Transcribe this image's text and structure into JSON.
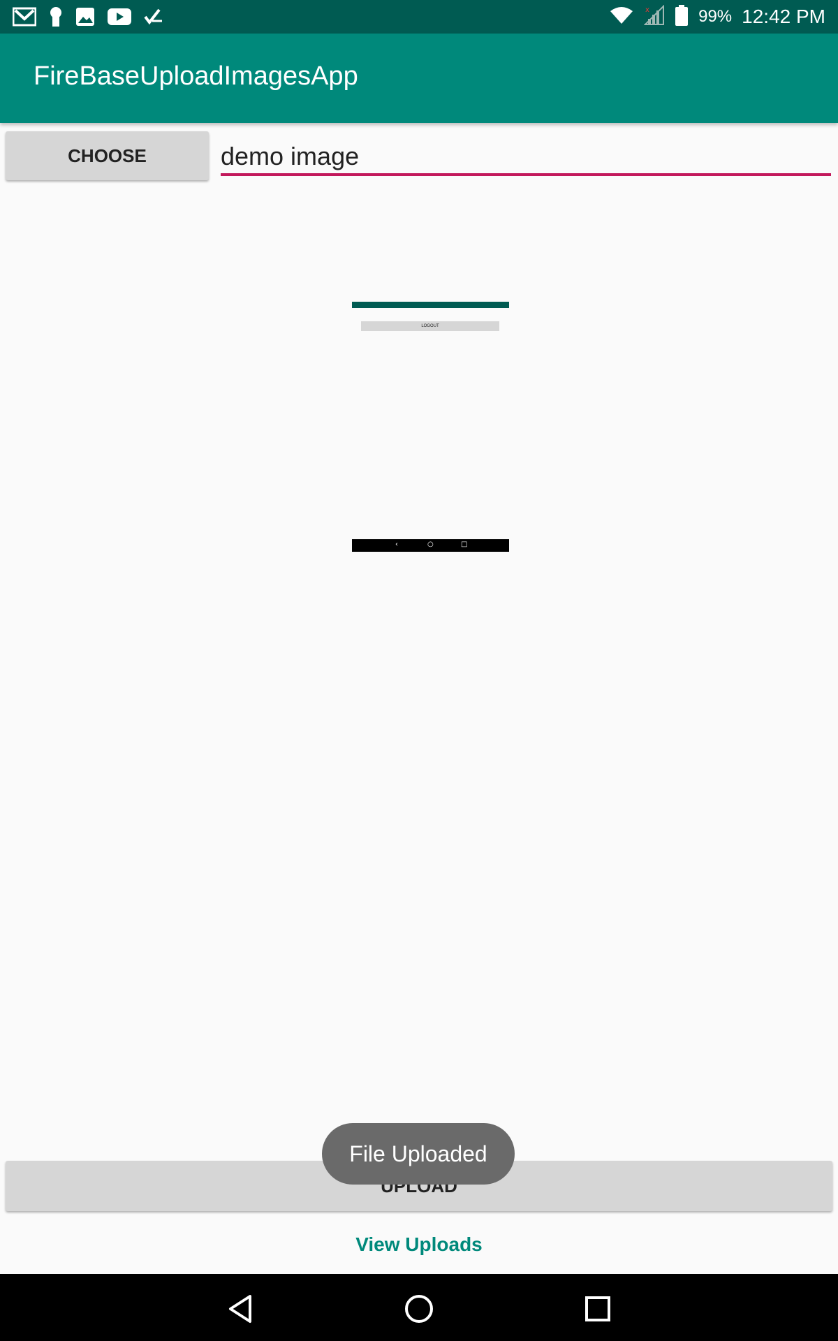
{
  "status_bar": {
    "battery_percent": "99%",
    "time": "12:42 PM",
    "left_icons": [
      "gmail-icon",
      "keyhole-icon",
      "image-icon",
      "youtube-icon",
      "checklist-icon"
    ],
    "right_icons": [
      "wifi-icon",
      "signal-icon",
      "battery-icon"
    ]
  },
  "app_bar": {
    "title": "FireBaseUploadImagesApp",
    "color": "#00897b"
  },
  "form": {
    "choose_label": "CHOOSE",
    "file_name_value": "demo image",
    "upload_label": "UPLOAD",
    "view_uploads_label": "View Uploads"
  },
  "preview": {
    "button_label": "LOGOUT"
  },
  "toast": {
    "message": "File Uploaded"
  },
  "colors": {
    "status_bar": "#005b52",
    "accent_underline": "#c2185b",
    "link": "#00897b",
    "button_bg": "#d6d6d6"
  }
}
